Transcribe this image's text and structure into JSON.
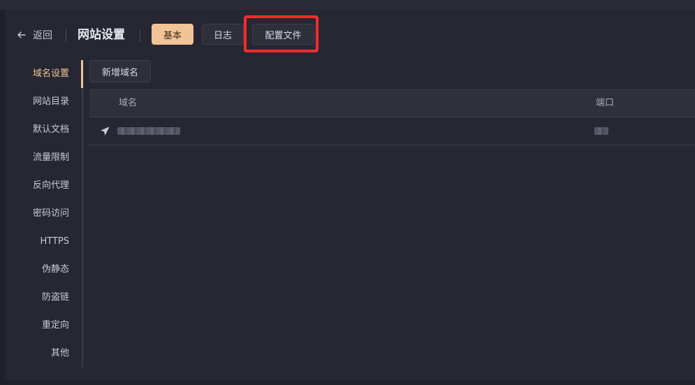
{
  "header": {
    "back_label": "返回",
    "title": "网站设置",
    "tabs": [
      {
        "label": "基本",
        "active": true
      },
      {
        "label": "日志",
        "active": false
      },
      {
        "label": "配置文件",
        "active": false
      }
    ]
  },
  "sidebar": {
    "items": [
      {
        "label": "域名设置",
        "active": true
      },
      {
        "label": "网站目录"
      },
      {
        "label": "默认文档"
      },
      {
        "label": "流量限制"
      },
      {
        "label": "反向代理"
      },
      {
        "label": "密码访问"
      },
      {
        "label": "HTTPS"
      },
      {
        "label": "伪静态"
      },
      {
        "label": "防盗链"
      },
      {
        "label": "重定向"
      },
      {
        "label": "其他"
      }
    ]
  },
  "content": {
    "add_button": "新增域名",
    "table": {
      "columns": [
        "域名",
        "端口"
      ],
      "rows": [
        {
          "domain": "",
          "port": "",
          "icon": "send-icon",
          "redacted": true
        }
      ]
    }
  },
  "colors": {
    "accent": "#f1c395",
    "highlight_box": "#ff2a2a",
    "background": "#1f2029",
    "panel": "#262733"
  }
}
